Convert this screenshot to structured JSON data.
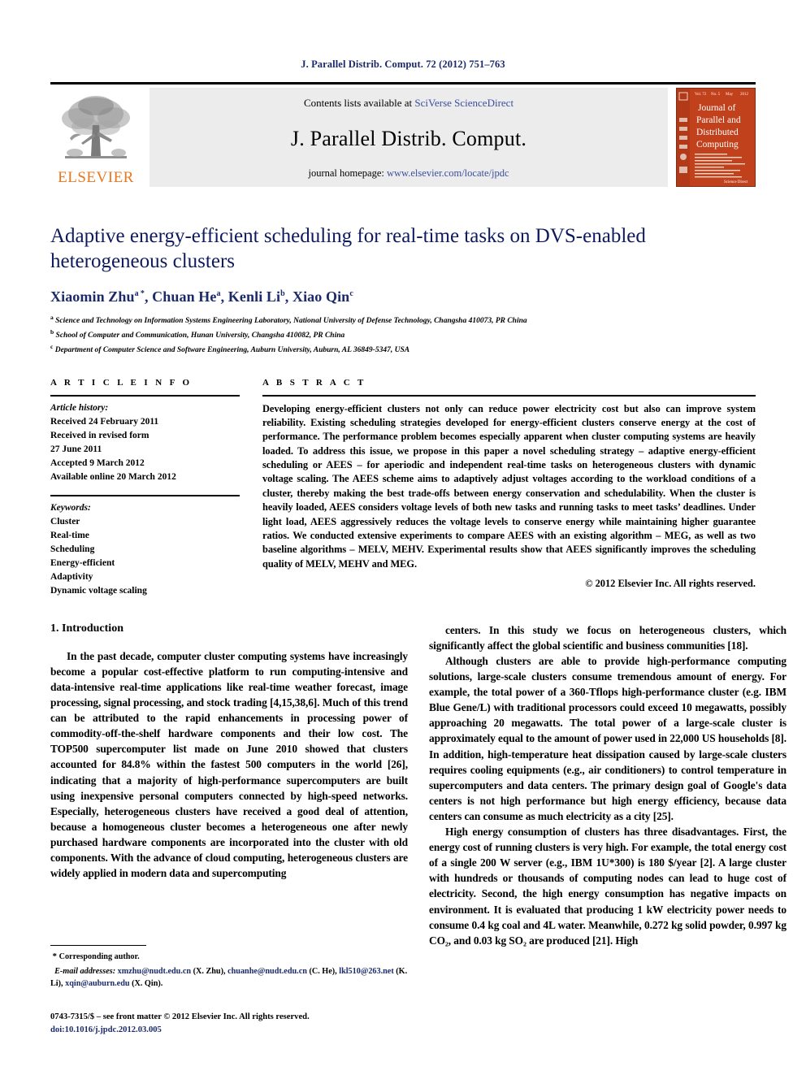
{
  "running_head": "J. Parallel Distrib. Comput. 72 (2012) 751–763",
  "masthead": {
    "publisher_name": "ELSEVIER",
    "contents_prefix": "Contents lists available at ",
    "contents_link": "SciVerse ScienceDirect",
    "journal_title": "J. Parallel Distrib. Comput.",
    "homepage_prefix": "journal homepage: ",
    "homepage_link": "www.elsevier.com/locate/jpdc",
    "cover": {
      "line1": "Journal of",
      "line2": "Parallel and",
      "line3": "Distributed",
      "line4": "Computing",
      "footer": "Science Direct",
      "bg_color": "#c2411d"
    }
  },
  "article": {
    "title": "Adaptive energy-efficient scheduling for real-time tasks on DVS-enabled heterogeneous clusters",
    "authors": [
      {
        "name": "Xiaomin Zhu",
        "sup": "a *"
      },
      {
        "name": "Chuan He",
        "sup": "a"
      },
      {
        "name": "Kenli Li",
        "sup": "b"
      },
      {
        "name": "Xiao Qin",
        "sup": "c"
      }
    ],
    "affiliations": [
      {
        "mark": "a",
        "text": "Science and Technology on Information Systems Engineering Laboratory, National University of Defense Technology, Changsha 410073, PR China"
      },
      {
        "mark": "b",
        "text": "School of Computer and Communication, Hunan University, Changsha 410082, PR China"
      },
      {
        "mark": "c",
        "text": "Department of Computer Science and Software Engineering, Auburn University, Auburn, AL 36849-5347, USA"
      }
    ]
  },
  "article_info": {
    "heading": "A R T I C L E    I N F O",
    "history_label": "Article history:",
    "history": [
      "Received 24 February 2011",
      "Received in revised form",
      "27 June 2011",
      "Accepted 9 March 2012",
      "Available online 20 March 2012"
    ],
    "keywords_label": "Keywords:",
    "keywords": [
      "Cluster",
      "Real-time",
      "Scheduling",
      "Energy-efficient",
      "Adaptivity",
      "Dynamic voltage scaling"
    ]
  },
  "abstract": {
    "heading": "A B S T R A C T",
    "text": "Developing energy-efficient clusters not only can reduce power electricity cost but also can improve system reliability. Existing scheduling strategies developed for energy-efficient clusters conserve energy at the cost of performance. The performance problem becomes especially apparent when cluster computing systems are heavily loaded. To address this issue, we propose in this paper a novel scheduling strategy – adaptive energy-efficient scheduling or AEES – for aperiodic and independent real-time tasks on heterogeneous clusters with dynamic voltage scaling. The AEES scheme aims to adaptively adjust voltages according to the workload conditions of a cluster, thereby making the best trade-offs between energy conservation and schedulability. When the cluster is heavily loaded, AEES considers voltage levels of both new tasks and running tasks to meet tasks’ deadlines. Under light load, AEES aggressively reduces the voltage levels to conserve energy while maintaining higher guarantee ratios. We conducted extensive experiments to compare AEES with an existing algorithm – MEG, as well as two baseline algorithms – MELV, MEHV. Experimental results show that AEES significantly improves the scheduling quality of MELV, MEHV and MEG.",
    "copyright": "© 2012 Elsevier Inc. All rights reserved."
  },
  "body": {
    "section_number_title": "1. Introduction",
    "left_paragraphs": [
      "In the past decade, computer cluster computing systems have increasingly become a popular cost-effective platform to run computing-intensive and data-intensive real-time applications like real-time weather forecast, image processing, signal processing, and stock trading [4,15,38,6]. Much of this trend can be attributed to the rapid enhancements in processing power of commodity-off-the-shelf hardware components and their low cost. The TOP500 supercomputer list made on June 2010 showed that clusters accounted for 84.8% within the fastest 500 computers in the world [26], indicating that a majority of high-performance supercomputers are built using inexpensive personal computers connected by high-speed networks. Especially, heterogeneous clusters have received a good deal of attention, because a homogeneous cluster becomes a heterogeneous one after newly purchased hardware components are incorporated into the cluster with old components. With the advance of cloud computing, heterogeneous clusters are widely applied in modern data and supercomputing"
    ],
    "right_paragraphs": [
      "centers. In this study we focus on heterogeneous clusters, which significantly affect the global scientific and business communities [18].",
      "Although clusters are able to provide high-performance computing solutions, large-scale clusters consume tremendous amount of energy. For example, the total power of a 360-Tflops high-performance cluster (e.g. IBM Blue Gene/L) with traditional processors could exceed 10 megawatts, possibly approaching 20 megawatts. The total power of a large-scale cluster is approximately equal to the amount of power used in 22,000 US households [8]. In addition, high-temperature heat dissipation caused by large-scale clusters requires cooling equipments (e.g., air conditioners) to control temperature in supercomputers and data centers. The primary design goal of Google's data centers is not high performance but high energy efficiency, because data centers can consume as much electricity as a city [25].",
      "High energy consumption of clusters has three disadvantages. First, the energy cost of running clusters is very high. For example, the total energy cost of a single 200 W server (e.g., IBM 1U*300) is 180 $/year [2]. A large cluster with hundreds or thousands of computing nodes can lead to huge cost of electricity. Second, the high energy consumption has negative impacts on environment. It is evaluated that producing 1 kW electricity power needs to consume 0.4 kg coal and 4L water. Meanwhile, 0.272 kg solid powder, 0.997 kg CO₂, and 0.03 kg SO₂ are produced [21]. High"
    ]
  },
  "footnotes": {
    "corresponding": "Corresponding author.",
    "corresponding_mark": "*",
    "email_label": "E-mail addresses:",
    "emails": [
      {
        "address": "xmzhu@nudt.edu.cn",
        "owner": "(X. Zhu),"
      },
      {
        "address": "chuanhe@nudt.edu.cn",
        "owner": "(C. He),"
      },
      {
        "address": "lkl510@263.net",
        "owner": "(K. Li),"
      },
      {
        "address": "xqin@auburn.edu",
        "owner": "(X. Qin)."
      }
    ]
  },
  "imprint": {
    "issn_line": "0743-7315/$ – see front matter © 2012 Elsevier Inc. All rights reserved.",
    "doi_line": "doi:10.1016/j.jpdc.2012.03.005"
  },
  "colors": {
    "title_blue": "#0d1a5e",
    "link_blue": "#3b4fa0",
    "ref_blue": "#2b3fa0",
    "elsevier_orange": "#e87722",
    "cover_red": "#c2411d"
  }
}
